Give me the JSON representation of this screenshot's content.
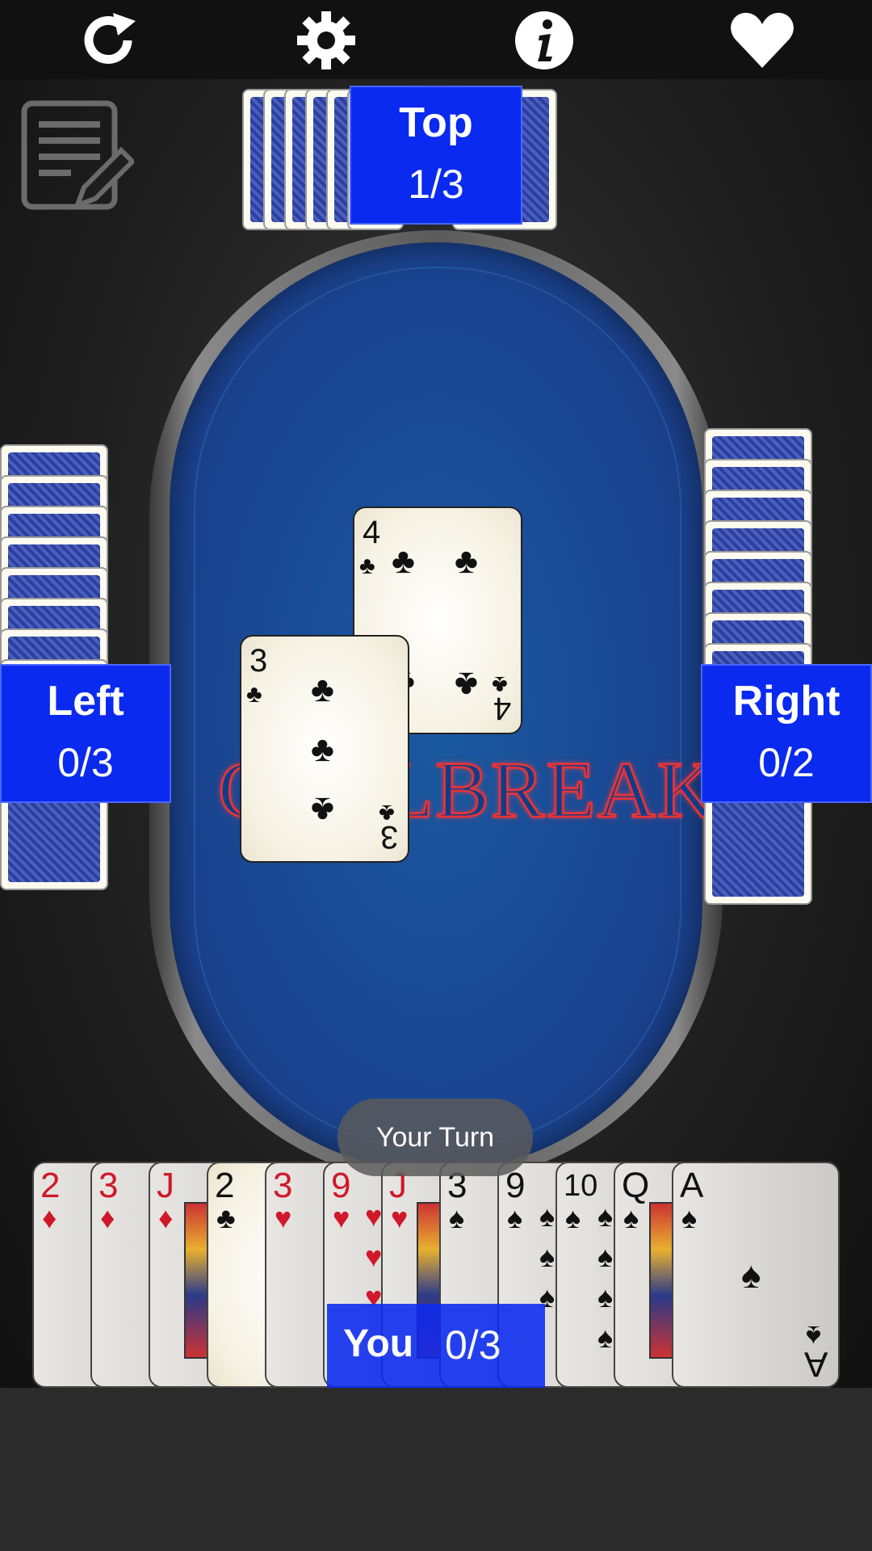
{
  "toolbar": {
    "restart_icon": "restart-icon",
    "settings_icon": "gear-icon",
    "info_icon": "info-icon",
    "favorite_icon": "heart-icon"
  },
  "notes_icon": "scorecard-edit-icon",
  "table": {
    "logo_text": "CALLBREAK"
  },
  "players": {
    "top": {
      "name": "Top",
      "score": "1/3"
    },
    "left": {
      "name": "Left",
      "score": "0/3"
    },
    "right": {
      "name": "Right",
      "score": "0/2"
    },
    "you": {
      "name": "You",
      "score": "0/3"
    }
  },
  "trick": [
    {
      "rank": "4",
      "suit": "♣",
      "color": "black"
    },
    {
      "rank": "3",
      "suit": "♣",
      "color": "black"
    }
  ],
  "toast": "Your Turn",
  "hand": [
    {
      "rank": "2",
      "suit": "♦",
      "color": "red",
      "playable": false
    },
    {
      "rank": "3",
      "suit": "♦",
      "color": "red",
      "playable": false
    },
    {
      "rank": "J",
      "suit": "♦",
      "color": "red",
      "playable": false
    },
    {
      "rank": "2",
      "suit": "♣",
      "color": "black",
      "playable": true
    },
    {
      "rank": "3",
      "suit": "♥",
      "color": "red",
      "playable": false
    },
    {
      "rank": "9",
      "suit": "♥",
      "color": "red",
      "playable": false
    },
    {
      "rank": "J",
      "suit": "♥",
      "color": "red",
      "playable": false
    },
    {
      "rank": "3",
      "suit": "♠",
      "color": "black",
      "playable": false
    },
    {
      "rank": "9",
      "suit": "♠",
      "color": "black",
      "playable": false
    },
    {
      "rank": "10",
      "suit": "♠",
      "color": "black",
      "playable": false
    },
    {
      "rank": "Q",
      "suit": "♠",
      "color": "black",
      "playable": false
    },
    {
      "rank": "A",
      "suit": "♠",
      "color": "black",
      "playable": false
    }
  ],
  "colors": {
    "label_blue": "#0a2af0",
    "felt": "#1a4a95"
  }
}
